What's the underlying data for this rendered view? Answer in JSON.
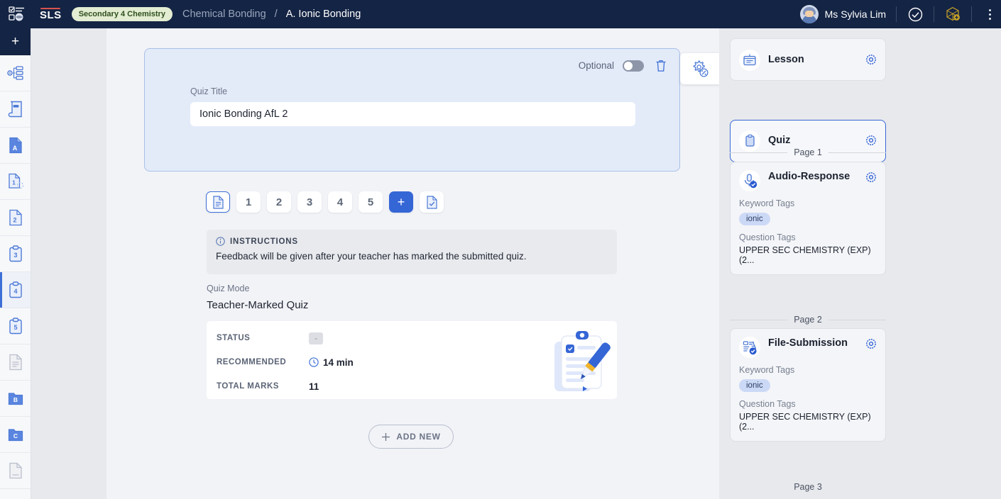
{
  "topbar": {
    "app_logo": "sls-logo-icon",
    "brand": "SLS",
    "class_badge": "Secondary 4 Chemistry",
    "breadcrumb_parent": "Chemical Bonding",
    "breadcrumb_sep": "/",
    "breadcrumb_current": "A. Ionic Bonding",
    "user_name": "Ms Sylvia Lim",
    "check_icon": "check-circle-icon",
    "network_icon": "network-add-icon",
    "menu_icon": "kebab-menu-icon"
  },
  "rail": {
    "add_label": "+",
    "items": [
      {
        "name": "sidebar-item-settings-tree",
        "icon": "settings-tree-icon",
        "active": false
      },
      {
        "name": "sidebar-item-notebook",
        "icon": "notebook-icon",
        "active": false
      },
      {
        "name": "sidebar-item-a",
        "icon": "file-a-icon",
        "active": false
      },
      {
        "name": "sidebar-item-1",
        "icon": "file-1-icon",
        "active": false
      },
      {
        "name": "sidebar-item-2",
        "icon": "file-2-icon",
        "active": false
      },
      {
        "name": "sidebar-item-3",
        "icon": "clipboard-3-icon",
        "active": false
      },
      {
        "name": "sidebar-item-4",
        "icon": "clipboard-4-icon",
        "active": true
      },
      {
        "name": "sidebar-item-5",
        "icon": "clipboard-5-icon",
        "active": false
      },
      {
        "name": "sidebar-item-document",
        "icon": "document-lines-icon",
        "active": false
      },
      {
        "name": "sidebar-item-b",
        "icon": "folder-b-icon",
        "active": false
      },
      {
        "name": "sidebar-item-c",
        "icon": "folder-c-icon",
        "active": false
      },
      {
        "name": "sidebar-item-blank",
        "icon": "blank-page-icon",
        "active": false
      }
    ]
  },
  "quiz_card": {
    "optional_label": "Optional",
    "optional_on": false,
    "delete_icon": "trash-icon",
    "settings_icon": "settings-collapse-icon",
    "title_label": "Quiz Title",
    "title_value": "Ionic Bonding AfL 2",
    "title_placeholder": "Quiz Title"
  },
  "page_chips": {
    "doc_icon": "document-icon",
    "numbers": [
      "1",
      "2",
      "3",
      "4",
      "5"
    ],
    "add_label": "+",
    "check_doc_icon": "document-check-icon"
  },
  "instructions": {
    "icon": "info-icon",
    "heading": "INSTRUCTIONS",
    "body": "Feedback will be given after your teacher has marked the submitted quiz."
  },
  "quiz_mode": {
    "label": "Quiz Mode",
    "value": "Teacher-Marked Quiz"
  },
  "stats": {
    "rows": [
      {
        "key": "STATUS",
        "value": "-",
        "is_dash": true,
        "icon": ""
      },
      {
        "key": "RECOMMENDED",
        "value": "14 min",
        "is_dash": false,
        "icon": "clock-icon"
      },
      {
        "key": "TOTAL MARKS",
        "value": "11",
        "is_dash": false,
        "icon": ""
      }
    ],
    "illustration": "clipboard-pen-illustration"
  },
  "add_new": {
    "label": "ADD NEW",
    "icon": "plus-icon"
  },
  "right_panel": {
    "top_cards": [
      {
        "title": "Lesson",
        "icon": "lesson-board-icon",
        "gear": "gear-icon",
        "selected": false
      },
      {
        "title": "Quiz",
        "icon": "quiz-clipboard-icon",
        "gear": "gear-icon",
        "selected": true
      }
    ],
    "sections": [
      {
        "divider": "Page 1",
        "card": {
          "title": "Audio-Response",
          "icon": "microphone-check-icon",
          "gear": "gear-icon",
          "keyword_label": "Keyword Tags",
          "keyword_tags": [
            "ionic"
          ],
          "question_label": "Question Tags",
          "question_tag": "UPPER SEC CHEMISTRY (EXP) (2..."
        }
      },
      {
        "divider": "Page 2",
        "card": {
          "title": "File-Submission",
          "icon": "file-submission-check-icon",
          "gear": "gear-icon",
          "keyword_label": "Keyword Tags",
          "keyword_tags": [
            "ionic"
          ],
          "question_label": "Question Tags",
          "question_tag": "UPPER SEC CHEMISTRY (EXP) (2..."
        }
      }
    ],
    "last_divider": "Page 3"
  },
  "colors": {
    "header_bg": "#142444",
    "accent_blue": "#3566d6",
    "card_blue": "#e3ebf9",
    "badge_green_bg": "#e3edd2",
    "badge_green_text": "#2f4f1e",
    "tag_pill_bg": "#ccd9f6",
    "panel_bg": "#e8e9ed"
  }
}
